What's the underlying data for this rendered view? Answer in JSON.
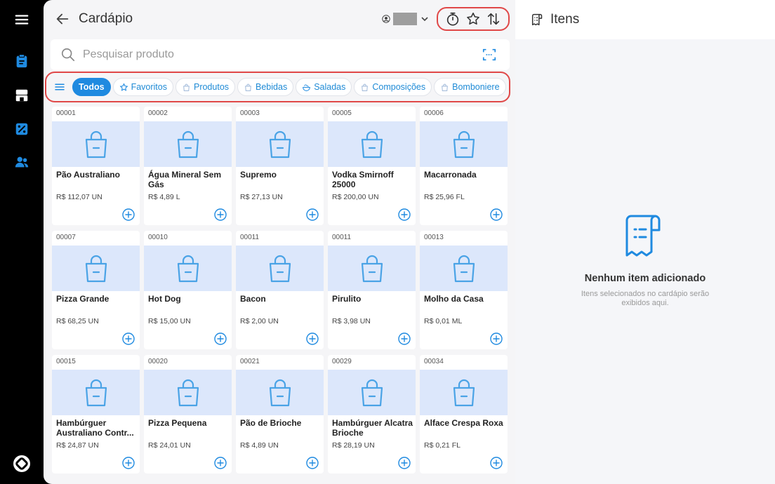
{
  "sidebar": {
    "icons": [
      "menu-icon",
      "clipboard-icon",
      "store-icon",
      "discount-icon",
      "users-icon",
      "app-logo-icon"
    ]
  },
  "header": {
    "title": "Cardápio",
    "tools": [
      "timer-icon",
      "star-icon",
      "sort-icon"
    ]
  },
  "search": {
    "placeholder": "Pesquisar produto"
  },
  "categories": [
    {
      "label": "Todos",
      "active": true
    },
    {
      "label": "Favoritos",
      "icon": "star-icon"
    },
    {
      "label": "Produtos",
      "icon": "bag-icon"
    },
    {
      "label": "Bebidas",
      "icon": "bag-icon"
    },
    {
      "label": "Saladas",
      "icon": "salad-icon"
    },
    {
      "label": "Composições",
      "icon": "bag-icon"
    },
    {
      "label": "Bomboniere",
      "icon": "bag-icon"
    }
  ],
  "products": [
    {
      "code": "00001",
      "name": "Pão Australiano",
      "price": "R$ 112,07 UN"
    },
    {
      "code": "00002",
      "name": "Água Mineral Sem Gás",
      "price": "R$ 4,89 L"
    },
    {
      "code": "00003",
      "name": "Supremo",
      "price": "R$ 27,13 UN"
    },
    {
      "code": "00005",
      "name": "Vodka Smirnoff 25000",
      "price": "R$ 200,00 UN"
    },
    {
      "code": "00006",
      "name": "Macarronada",
      "price": "R$ 25,96 FL"
    },
    {
      "code": "00007",
      "name": "Pizza Grande",
      "price": "R$ 68,25 UN"
    },
    {
      "code": "00010",
      "name": "Hot Dog",
      "price": "R$ 15,00 UN"
    },
    {
      "code": "00011",
      "name": "Bacon",
      "price": "R$ 2,00 UN"
    },
    {
      "code": "00011",
      "name": "Pirulito",
      "price": "R$ 3,98 UN"
    },
    {
      "code": "00013",
      "name": "Molho da Casa",
      "price": "R$ 0,01 ML"
    },
    {
      "code": "00015",
      "name": "Hambúrguer Australiano Contr...",
      "price": "R$ 24,87 UN"
    },
    {
      "code": "00020",
      "name": "Pizza Pequena",
      "price": "R$ 24,01 UN"
    },
    {
      "code": "00021",
      "name": "Pão de Brioche",
      "price": "R$ 4,89 UN"
    },
    {
      "code": "00029",
      "name": "Hambúrguer Alcatra Brioche",
      "price": "R$ 28,19 UN"
    },
    {
      "code": "00034",
      "name": "Alface Crespa Roxa",
      "price": "R$ 0,21 FL"
    }
  ],
  "itens_panel": {
    "title": "Itens",
    "empty_title": "Nenhum item adicionado",
    "empty_subtitle": "Itens selecionados no cardápio serão exibidos aqui."
  },
  "colors": {
    "accent": "#1f8ae0",
    "highlight": "#e04848",
    "card_image_bg": "#dce7fb"
  }
}
